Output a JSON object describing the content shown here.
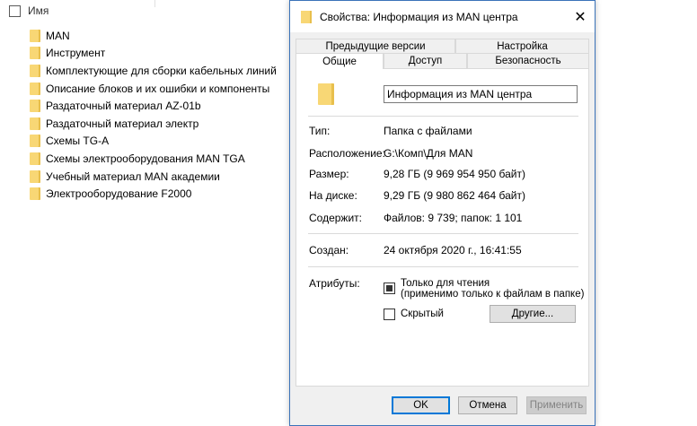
{
  "explorer": {
    "column_header": "Имя",
    "items": [
      "MAN",
      "Инструмент",
      "Комплектующие для сборки кабельных линий",
      "Описание блоков и их ошибки и компоненты",
      "Раздаточный материал AZ-01b",
      "Раздаточный материал электр",
      "Схемы TG-A",
      "Схемы электрооборудования MAN TGA",
      "Учебный материал MAN академии",
      "Электрооборудование F2000"
    ]
  },
  "dialog": {
    "title": "Свойства: Информация из MAN центра",
    "close_glyph": "✕",
    "tabs_row1": [
      "Предыдущие версии",
      "Настройка"
    ],
    "tabs_row2": [
      "Общие",
      "Доступ",
      "Безопасность"
    ],
    "active_tab": "Общие",
    "folder_name": "Информация из MAN центра",
    "properties": {
      "type_label": "Тип:",
      "type_value": "Папка с файлами",
      "location_label": "Расположение:",
      "location_value": "G:\\Комп\\Для MAN",
      "size_label": "Размер:",
      "size_value": "9,28 ГБ (9 969 954 950 байт)",
      "disk_label": "На диске:",
      "disk_value": "9,29 ГБ (9 980 862 464 байт)",
      "contains_label": "Содержит:",
      "contains_value": "Файлов: 9 739; папок: 1 101",
      "created_label": "Создан:",
      "created_value": "24 октября 2020 г., 16:41:55",
      "attributes_label": "Атрибуты:"
    },
    "attributes": {
      "readonly_label": "Только для чтения",
      "readonly_note": "(применимо только к файлам в папке)",
      "hidden_label": "Скрытый",
      "other_button": "Другие..."
    },
    "buttons": {
      "ok": "OK",
      "cancel": "Отмена",
      "apply": "Применить"
    }
  }
}
